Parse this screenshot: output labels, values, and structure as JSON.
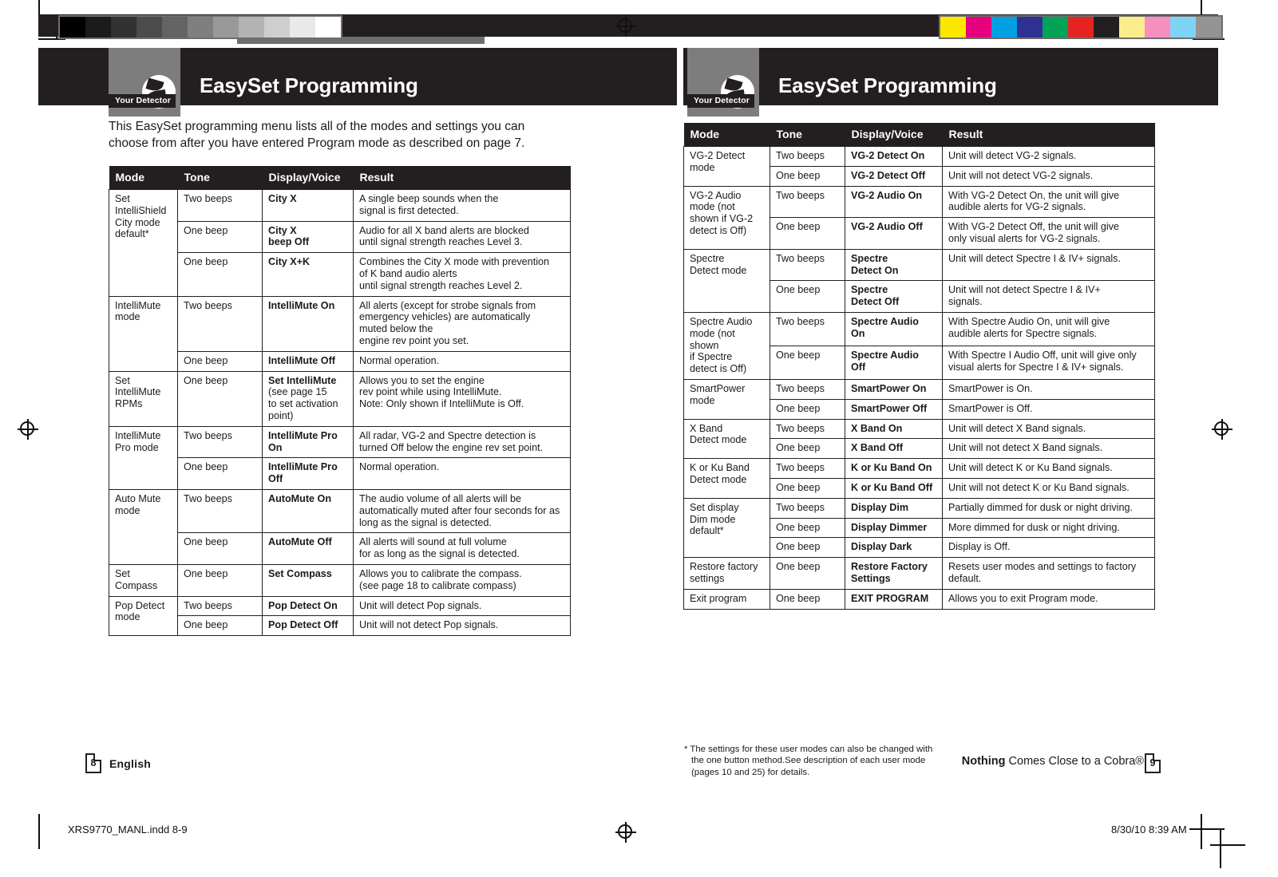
{
  "document": {
    "slug_left": "XRS9770_MANL.indd   8-9",
    "slug_right": "8/30/10   8:39 AM"
  },
  "colors": {
    "header_dark": "#231f20",
    "logo_grey": "#7d7d7d",
    "page_white": "#ffffff",
    "rule": "#231f20"
  },
  "grey_swatches": [
    "#000000",
    "#1c1a1b",
    "#333132",
    "#4c4a4b",
    "#656363",
    "#807e7f",
    "#9a9899",
    "#b4b3b3",
    "#cfcece",
    "#e9e9e9",
    "#ffffff"
  ],
  "color_swatches": [
    "#fde700",
    "#e6007e",
    "#00a0e3",
    "#2e3192",
    "#00a357",
    "#e52421",
    "#231f20",
    "#fbee8a",
    "#f48fc0",
    "#7fd4f5",
    "#949494"
  ],
  "left_page": {
    "header": {
      "logo_caption": "Your Detector",
      "title": "EasySet Programming",
      "icon": "radar-detector-icon"
    },
    "intro": "This EasySet programming menu lists all of the modes and settings you can choose from after you have entered Program mode as described on page 7.",
    "table": {
      "columns": [
        "Mode",
        "Tone",
        "Display/Voice",
        "Result"
      ],
      "groups": [
        {
          "mode": "Set\nIntelliShield\nCity mode\ndefault*",
          "rows": [
            {
              "tone": "Two beeps",
              "display": "City X",
              "result": "A single beep sounds when the\nsignal is first detected."
            },
            {
              "tone": "One beep",
              "display": "City X\nbeep Off",
              "result": "Audio for all X band alerts are blocked\nuntil signal strength reaches Level 3."
            },
            {
              "tone": "One beep",
              "display": "City X+K",
              "result": "Combines the City X mode with prevention\nof K band audio alerts\nuntil signal strength reaches Level 2."
            }
          ]
        },
        {
          "mode": "IntelliMute\nmode",
          "rows": [
            {
              "tone": "Two beeps",
              "display": "IntelliMute On",
              "result": "All alerts (except for strobe signals from\nemergency vehicles) are automatically\nmuted below the\nengine rev point you set."
            },
            {
              "tone": "One beep",
              "display": "IntelliMute Off",
              "result": "Normal operation."
            }
          ]
        },
        {
          "mode": "Set IntelliMute\nRPMs",
          "rows": [
            {
              "tone": "One beep",
              "display": "Set IntelliMute",
              "display_note": "(see page 15\nto set activation\npoint)",
              "result": "Allows you to set the engine\nrev point while using IntelliMute.\nNote: Only shown if IntelliMute is Off."
            }
          ]
        },
        {
          "mode": "IntelliMute\nPro mode",
          "rows": [
            {
              "tone": "Two beeps",
              "display": "IntelliMute Pro\nOn",
              "result": " All radar, VG-2 and Spectre detection is\n turned Off below the engine rev set point."
            },
            {
              "tone": "One beep",
              "display": "IntelliMute Pro\nOff",
              "result": "Normal operation."
            }
          ]
        },
        {
          "mode": "Auto Mute\nmode",
          "rows": [
            {
              "tone": "Two beeps",
              "display": "AutoMute On",
              "result": "The audio volume of all alerts will be\nautomatically muted after four seconds for as\nlong as the signal is detected."
            },
            {
              "tone": "One beep",
              "display": "AutoMute Off",
              "result": "All alerts will sound at full volume\nfor as long as the signal is detected."
            }
          ]
        },
        {
          "mode": "Set\nCompass",
          "rows": [
            {
              "tone": "One beep",
              "display": "Set Compass",
              "result": "Allows you to calibrate the compass.\n(see page 18 to calibrate compass)"
            }
          ]
        },
        {
          "mode": "Pop Detect\nmode",
          "rows": [
            {
              "tone": "Two beeps",
              "display": "Pop Detect On",
              "result": "Unit will detect Pop signals."
            },
            {
              "tone": "One beep",
              "display": "Pop Detect Off",
              "result": "Unit will not detect Pop signals."
            }
          ]
        }
      ]
    },
    "footer": {
      "page_number": "8",
      "language": "English"
    }
  },
  "right_page": {
    "header": {
      "logo_caption": "Your Detector",
      "title": "EasySet Programming",
      "icon": "radar-detector-icon"
    },
    "table": {
      "columns": [
        "Mode",
        "Tone",
        "Display/Voice",
        "Result"
      ],
      "groups": [
        {
          "mode": "VG-2 Detect\nmode",
          "rows": [
            {
              "tone": "Two beeps",
              "display": "VG-2 Detect On",
              "result": "Unit will detect VG-2 signals."
            },
            {
              "tone": "One beep",
              "display": "VG-2 Detect Off",
              "result": "Unit will not detect VG-2 signals."
            }
          ]
        },
        {
          "mode": "VG-2 Audio\nmode (not\nshown if VG-2\ndetect is Off)",
          "rows": [
            {
              "tone": "Two beeps",
              "display": "VG-2 Audio On",
              "result": "With VG-2 Detect On, the unit will give\naudible alerts for VG-2 signals."
            },
            {
              "tone": "One beep",
              "display": "VG-2 Audio Off",
              "result": "With VG-2 Detect Off, the unit will give\nonly visual alerts for VG-2 signals."
            }
          ]
        },
        {
          "mode": "Spectre\nDetect mode",
          "rows": [
            {
              "tone": "Two beeps",
              "display": "Spectre\nDetect On",
              "result": "Unit will detect Spectre I & IV+ signals."
            },
            {
              "tone": "One beep",
              "display": "Spectre\nDetect Off",
              "result": "Unit will not detect Spectre I & IV+\nsignals."
            }
          ]
        },
        {
          "mode": "Spectre  Audio\nmode (not\nshown\nif Spectre\ndetect is Off)",
          "rows": [
            {
              "tone": "Two beeps",
              "display": "Spectre Audio\nOn",
              "result": "With Spectre Audio On, unit will give\naudible alerts for Spectre signals."
            },
            {
              "tone": "One beep",
              "display": "Spectre Audio\nOff",
              "result": "With Spectre I Audio Off, unit will give only\nvisual alerts for Spectre I & IV+  signals."
            }
          ]
        },
        {
          "mode": "SmartPower\nmode",
          "rows": [
            {
              "tone": "Two beeps",
              "display": "SmartPower On",
              "result": "SmartPower is On."
            },
            {
              "tone": "One beep",
              "display": "SmartPower Off",
              "result": "SmartPower is Off."
            }
          ]
        },
        {
          "mode": "X Band\nDetect mode",
          "rows": [
            {
              "tone": "Two beeps",
              "display": "X Band On",
              "result": "Unit will detect X Band signals."
            },
            {
              "tone": "One beep",
              "display": "X Band Off",
              "result": "Unit will not detect X Band signals."
            }
          ]
        },
        {
          "mode": "K or Ku Band\nDetect mode",
          "rows": [
            {
              "tone": "Two beeps",
              "display": "K or Ku Band On",
              "result": "Unit will detect K or Ku Band signals."
            },
            {
              "tone": "One beep",
              "display": "K or Ku Band Off",
              "result": "Unit will not detect K or Ku Band signals."
            }
          ]
        },
        {
          "mode": "Set display\nDim mode\ndefault*",
          "rows": [
            {
              "tone": "Two beeps",
              "display": "Display Dim",
              "result": "Partially dimmed for dusk or night driving."
            },
            {
              "tone": "One beep",
              "display": "Display Dimmer",
              "result": "More dimmed for dusk or night driving."
            },
            {
              "tone": "One beep",
              "display": "Display Dark",
              "result": "Display is Off."
            }
          ]
        },
        {
          "mode": "Restore factory\nsettings",
          "rows": [
            {
              "tone": "One beep",
              "display": "Restore Factory\nSettings",
              "result": "Resets user modes and settings to factory\ndefault."
            }
          ]
        },
        {
          "mode": "Exit program",
          "rows": [
            {
              "tone": "One beep",
              "display": "EXIT PROGRAM",
              "result": "Allows you to exit Program mode."
            }
          ]
        }
      ]
    },
    "footnote_line1": "* The settings for these user modes can also be changed with",
    "footnote_line2": "the one button method.See description of each user mode",
    "footnote_line3": "(pages 10 and 25) for details.",
    "tagline_bold": "Nothing",
    "tagline_rest": " Comes Close to a Cobra®",
    "footer": {
      "page_number": "9"
    }
  }
}
